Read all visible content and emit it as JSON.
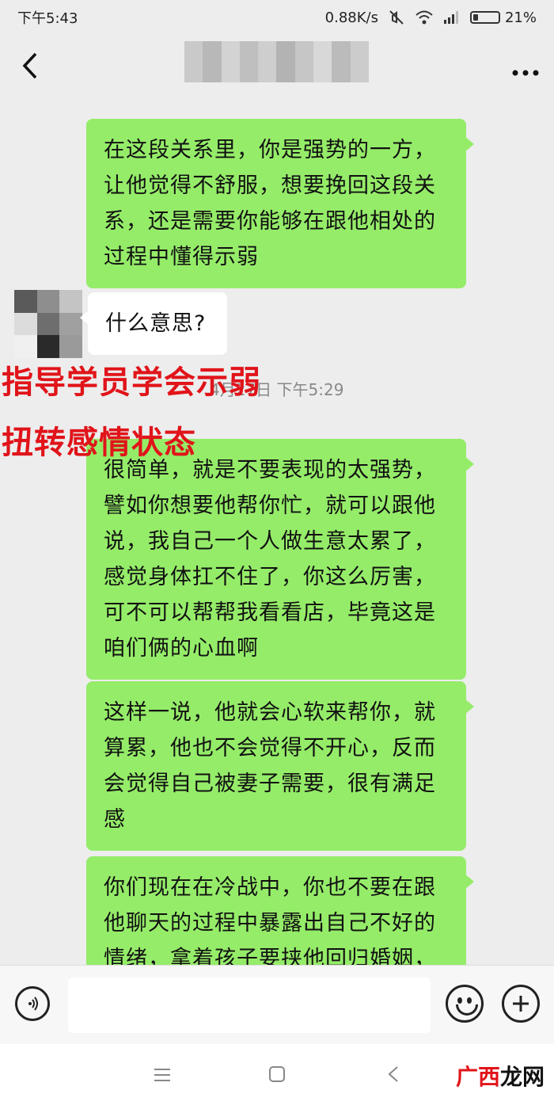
{
  "status_bar": {
    "time": "下午5:43",
    "speed": "0.88K/s",
    "battery": "21%",
    "battery_level": 0.21
  },
  "nav": {
    "back_icon": "chevron-left-icon",
    "more_icon": "more-dots-icon",
    "title_blurred_colors": [
      "#c9c9c9",
      "#b8b8b8",
      "#d3d3d3",
      "#bfbfbf",
      "#cecece",
      "#b3b3b3",
      "#c6c6c6",
      "#d8d8d8",
      "#bbbbbb",
      "#cccccc"
    ]
  },
  "messages": [
    {
      "side": "out",
      "text": "在这段关系里，你是强势的一方，让他觉得不舒服，想要挽回这段关系，还是需要你能够在跟他相处的过程中懂得示弱"
    },
    {
      "side": "in",
      "text": "什么意思?"
    },
    {
      "side": "out",
      "text": "很简单，就是不要表现的太强势，譬如你想要他帮你忙，就可以跟他说，我自己一个人做生意太累了，感觉身体扛不住了，你这么厉害，可不可以帮帮我看看店，毕竟这是咱们俩的心血啊"
    },
    {
      "side": "out",
      "text": "这样一说，他就会心软来帮你，就算累，他也不会觉得不开心，反而会觉得自己被妻子需要，很有满足感"
    },
    {
      "side": "out",
      "text": "你们现在在冷战中，你也不要在跟他聊天的过程中暴露出自己不好的情绪，拿着孩子要挟他回归婚姻，"
    }
  ],
  "timestamp": "4月27日 下午5:29",
  "overlay_lines": [
    "指导学员学会示弱",
    "扭转感情状态"
  ],
  "avatar_colors": [
    "#5a5a5a",
    "#8e8e8e",
    "#c4c4c4",
    "#dcdcdc",
    "#6e6e6e",
    "#a0a0a0",
    "#f0f0f0",
    "#2a2a2a",
    "#9a9a9a"
  ],
  "input_bar": {
    "voice_icon": "voice-icon",
    "emoji_icon": "emoji-icon",
    "plus_icon": "plus-icon",
    "text": ""
  },
  "system_nav": {
    "menu_icon": "menu-icon",
    "home_icon": "home-square-icon",
    "back_icon": "back-triangle-icon"
  },
  "watermark": {
    "text_red": "广西",
    "text_black": "龙网"
  }
}
